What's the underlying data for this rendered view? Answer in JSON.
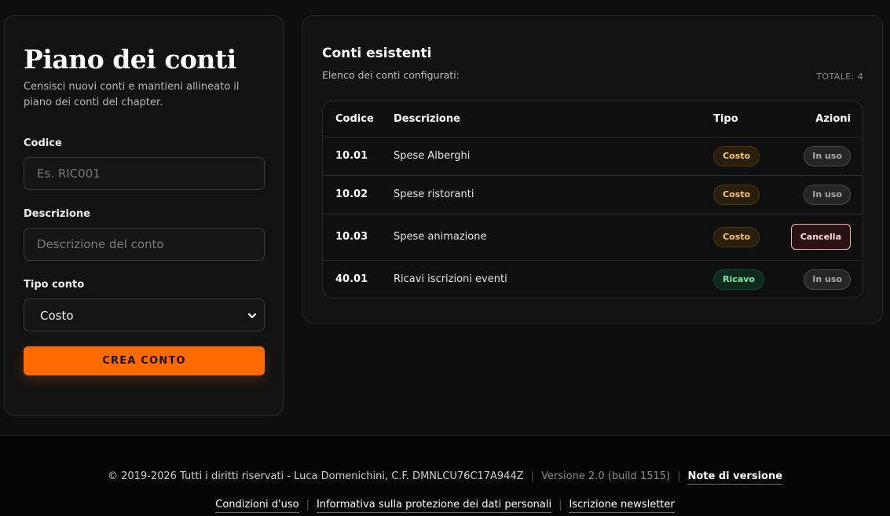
{
  "form": {
    "title": "Piano dei conti",
    "subtitle": "Censisci nuovi conti e mantieni allineato il piano dei conti del chapter.",
    "code_label": "Codice",
    "code_placeholder": "Es. RIC001",
    "description_label": "Descrizione",
    "description_placeholder": "Descrizione del conto",
    "type_label": "Tipo conto",
    "type_value": "Costo",
    "submit_label": "CREA CONTO"
  },
  "accounts": {
    "title": "Conti esistenti",
    "subtitle": "Elenco dei conti configurati:",
    "total": "TOTALE: 4",
    "columns": {
      "code": "Codice",
      "description": "Descrizione",
      "type": "Tipo",
      "actions": "Azioni"
    },
    "rows": [
      {
        "code": "10.01",
        "description": "Spese Alberghi",
        "type": "Costo",
        "action": "In uso"
      },
      {
        "code": "10.02",
        "description": "Spese ristoranti",
        "type": "Costo",
        "action": "In uso"
      },
      {
        "code": "10.03",
        "description": "Spese animazione",
        "type": "Costo",
        "action": "Cancella"
      },
      {
        "code": "40.01",
        "description": "Ricavi iscrizioni eventi",
        "type": "Ricavo",
        "action": "In uso"
      }
    ]
  },
  "footer": {
    "copyright": "© 2019-2026 Tutti i diritti riservati - Luca Domenichini, C.F. DMNLCU76C17A944Z",
    "version": "Versione 2.0 (build 1515)",
    "release_notes": "Note di versione",
    "terms": "Condizioni d'uso",
    "privacy": "Informativa sulla protezione dei dati personali",
    "newsletter": "Iscrizione newsletter",
    "separator": "|"
  },
  "colors": {
    "accent": "#ff6a00",
    "cost_badge": "#f5c56a",
    "revenue_badge": "#7fe5b0",
    "delete_border": "#f2b6b6"
  },
  "icons": {
    "select_arrow": "chevron-down-icon"
  }
}
